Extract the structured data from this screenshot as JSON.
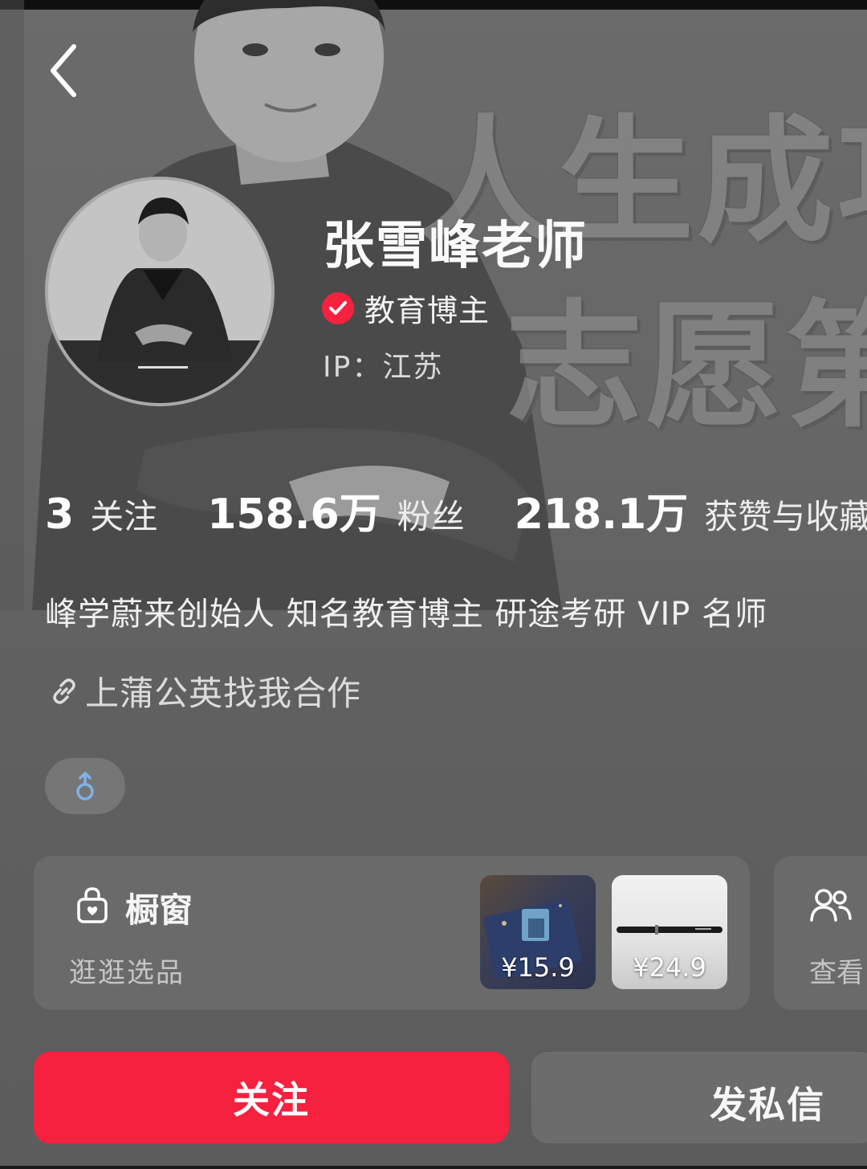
{
  "background": {
    "poster_line_1": "人生成功",
    "poster_line_2": "志愿第"
  },
  "header": {
    "back_icon": "chevron-left-icon"
  },
  "profile": {
    "name": "张雪峰老师",
    "verified_icon": "verified-check-icon",
    "badge": "教育博主",
    "ip": "IP：江苏"
  },
  "stats": [
    {
      "value": "3",
      "label": "关注"
    },
    {
      "value": "158.6万",
      "label": "粉丝"
    },
    {
      "value": "218.1万",
      "label": "获赞与收藏"
    }
  ],
  "bio": "峰学蔚来创始人 知名教育博主 研途考研 VIP 名师",
  "link": {
    "icon": "link-icon",
    "label": "上蒲公英找我合作"
  },
  "gender": {
    "icon": "male-icon"
  },
  "shop": {
    "icon": "shopping-bag-icon",
    "title": "橱窗",
    "subtitle": "逛逛选品",
    "products": [
      {
        "price": "¥15.9"
      },
      {
        "price": "¥24.9"
      }
    ]
  },
  "group": {
    "icon": "group-users-icon",
    "label": "查看"
  },
  "actions": {
    "follow": "关注",
    "message": "发私信"
  },
  "colors": {
    "accent": "#f6203f",
    "background": "#646464",
    "card": "#6a6a6a"
  }
}
